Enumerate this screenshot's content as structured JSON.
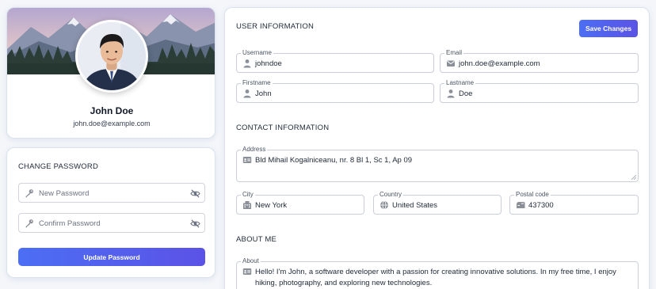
{
  "profile": {
    "name": "John Doe",
    "email": "john.doe@example.com"
  },
  "change_password": {
    "title": "CHANGE PASSWORD",
    "new_password_placeholder": "New Password",
    "confirm_password_placeholder": "Confirm Password",
    "update_button": "Update Password"
  },
  "user_information": {
    "title": "USER INFORMATION",
    "save_button": "Save Changes",
    "username": {
      "label": "Username",
      "value": "johndoe",
      "icon": "person-icon"
    },
    "email": {
      "label": "Email",
      "value": "john.doe@example.com",
      "icon": "envelope-icon"
    },
    "firstname": {
      "label": "Firstname",
      "value": "John",
      "icon": "person-icon"
    },
    "lastname": {
      "label": "Lastname",
      "value": "Doe",
      "icon": "person-icon"
    }
  },
  "contact_information": {
    "title": "CONTACT INFORMATION",
    "address": {
      "label": "Address",
      "value": "Bld Mihail Kogalniceanu, nr. 8 Bl 1, Sc 1, Ap 09",
      "icon": "id-card-icon"
    },
    "city": {
      "label": "City",
      "value": "New York",
      "icon": "building-icon"
    },
    "country": {
      "label": "Country",
      "value": "United States",
      "icon": "globe-icon"
    },
    "postal_code": {
      "label": "Postal code",
      "value": "437300",
      "icon": "mailbox-icon"
    }
  },
  "about_me": {
    "title": "ABOUT ME",
    "about": {
      "label": "About",
      "value": "Hello! I'm John, a software developer with a passion for creating innovative solutions. In my free time, I enjoy hiking, photography, and exploring new technologies.",
      "icon": "id-card-icon"
    }
  },
  "colors": {
    "accent_start": "#4c6ef5",
    "accent_end": "#5b52e6",
    "page_background": "#f4f6fa",
    "card_border": "#dbe2ee"
  }
}
